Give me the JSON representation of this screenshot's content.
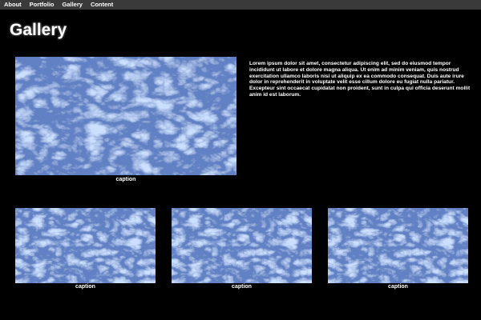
{
  "nav": {
    "items": [
      {
        "label": "About"
      },
      {
        "label": "Portfolio"
      },
      {
        "label": "Gallery"
      },
      {
        "label": "Content"
      }
    ]
  },
  "page": {
    "title": "Gallery"
  },
  "featured": {
    "caption": "caption",
    "description": "Lorem ipsum dolor sit amet, consectetur adipiscing elit, sed do eiusmod tempor incididunt ut labore et dolore magna aliqua. Ut enim ad minim veniam, quis nostrud exercitation ullamco laboris nisi ut aliquip ex ea commodo consequat. Duis aute irure dolor in reprehenderit in voluptate velit esse cillum dolore eu fugiat nulla pariatur. Excepteur sint occaecat cupidatat non proident, sunt in culpa qui officia deserunt mollit anim id est laborum."
  },
  "gallery": {
    "items": [
      {
        "caption": "caption"
      },
      {
        "caption": "caption"
      },
      {
        "caption": "caption"
      }
    ]
  },
  "colors": {
    "background": "#000000",
    "nav_background": "#3a3a3a",
    "image_base": "#1d3c8c",
    "image_highlight": "#6f9cff"
  }
}
